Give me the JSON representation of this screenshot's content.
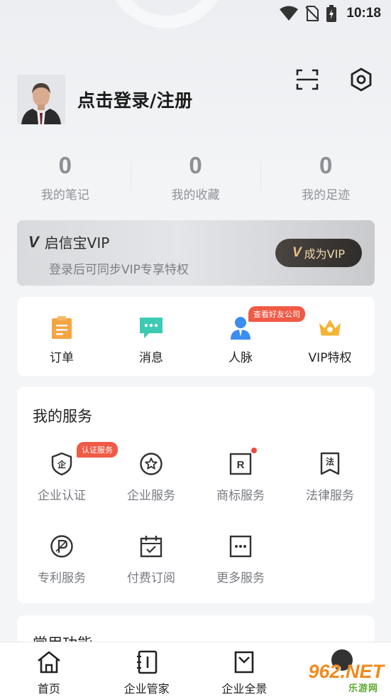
{
  "status_bar": {
    "time": "10:18"
  },
  "profile": {
    "login_text": "点击登录/注册"
  },
  "header": {
    "scan_icon": "scan-icon",
    "settings_icon": "settings-icon"
  },
  "stats": [
    {
      "value": "0",
      "label": "我的笔记"
    },
    {
      "value": "0",
      "label": "我的收藏"
    },
    {
      "value": "0",
      "label": "我的足迹"
    }
  ],
  "vip": {
    "logo": "V",
    "name": "启信宝VIP",
    "subtitle": "登录后可同步VIP专享特权",
    "button_logo": "V",
    "button_label": "成为VIP"
  },
  "quick_actions": [
    {
      "label": "订单",
      "icon": "clipboard-icon",
      "color": "#f5a442"
    },
    {
      "label": "消息",
      "icon": "message-icon",
      "color": "#3ccab4"
    },
    {
      "label": "人脉",
      "icon": "contact-icon",
      "color": "#3c8df0",
      "badge": "查看好友公司"
    },
    {
      "label": "VIP特权",
      "icon": "crown-icon",
      "color": "#f5b335"
    }
  ],
  "services": {
    "title": "我的服务",
    "items": [
      {
        "label": "企业认证",
        "icon": "enterprise-shield-icon",
        "glyph": "企",
        "badge": "认证服务"
      },
      {
        "label": "企业服务",
        "icon": "star-circle-icon"
      },
      {
        "label": "商标服务",
        "icon": "trademark-icon",
        "glyph": "R",
        "dot": true
      },
      {
        "label": "法律服务",
        "icon": "law-icon",
        "glyph": "法"
      },
      {
        "label": "专利服务",
        "icon": "patent-icon"
      },
      {
        "label": "付费订阅",
        "icon": "calendar-check-icon"
      },
      {
        "label": "更多服务",
        "icon": "more-icon"
      }
    ]
  },
  "common": {
    "title": "常用功能"
  },
  "tabbar": [
    {
      "label": "首页",
      "icon": "home-icon"
    },
    {
      "label": "企业管家",
      "icon": "notebook-icon"
    },
    {
      "label": "企业全景",
      "icon": "envelope-icon"
    },
    {
      "label": "",
      "icon": "profile-avatar-icon"
    }
  ],
  "watermark": {
    "number": "962.NET",
    "text": "乐游网"
  }
}
